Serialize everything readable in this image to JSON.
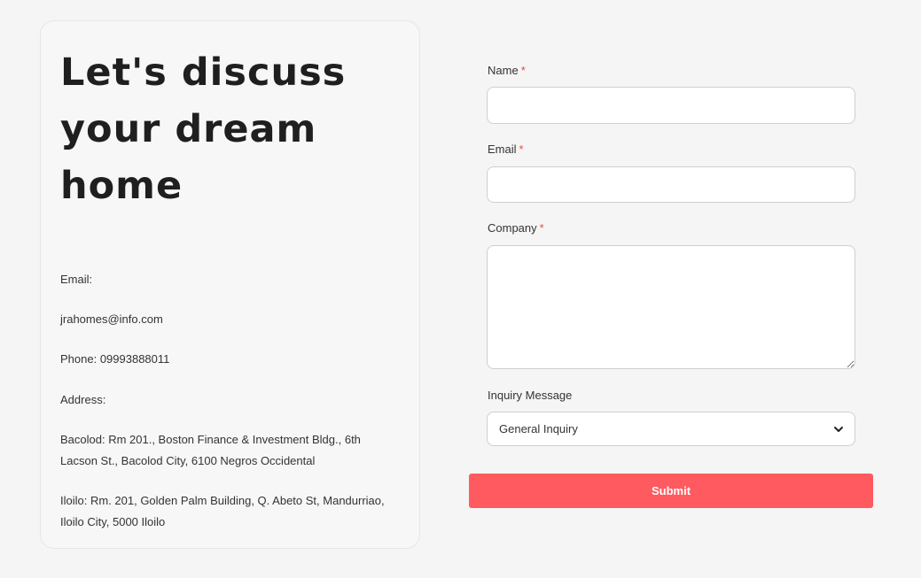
{
  "contact": {
    "headline": "Let's discuss your dream home",
    "email_label": "Email:",
    "email_value": "jrahomes@info.com",
    "phone": "Phone: 09993888011",
    "address_label": "Address:",
    "bacolod": "Bacolod: Rm 201., Boston Finance & Investment Bldg., 6th Lacson St., Bacolod City, 6100 Negros Occidental",
    "iloilo": "Iloilo: Rm. 201, Golden Palm Building, Q. Abeto St, Mandurriao, Iloilo City, 5000 Iloilo"
  },
  "form": {
    "name_label": "Name",
    "email_label": "Email",
    "company_label": "Company",
    "required_marker": "*",
    "name_value": "",
    "email_value": "",
    "company_value": "",
    "inquiry_label": "Inquiry Message",
    "inquiry_selected": "General Inquiry",
    "submit_label": "Submit"
  },
  "icons": {
    "select_arrow": "chevron-down-icon"
  },
  "colors": {
    "background": "#f5f5f5",
    "card_background": "#f7f7f7",
    "required": "#e64a4a",
    "submit_button": "#ff5a5f",
    "submit_text": "#ffffff"
  }
}
